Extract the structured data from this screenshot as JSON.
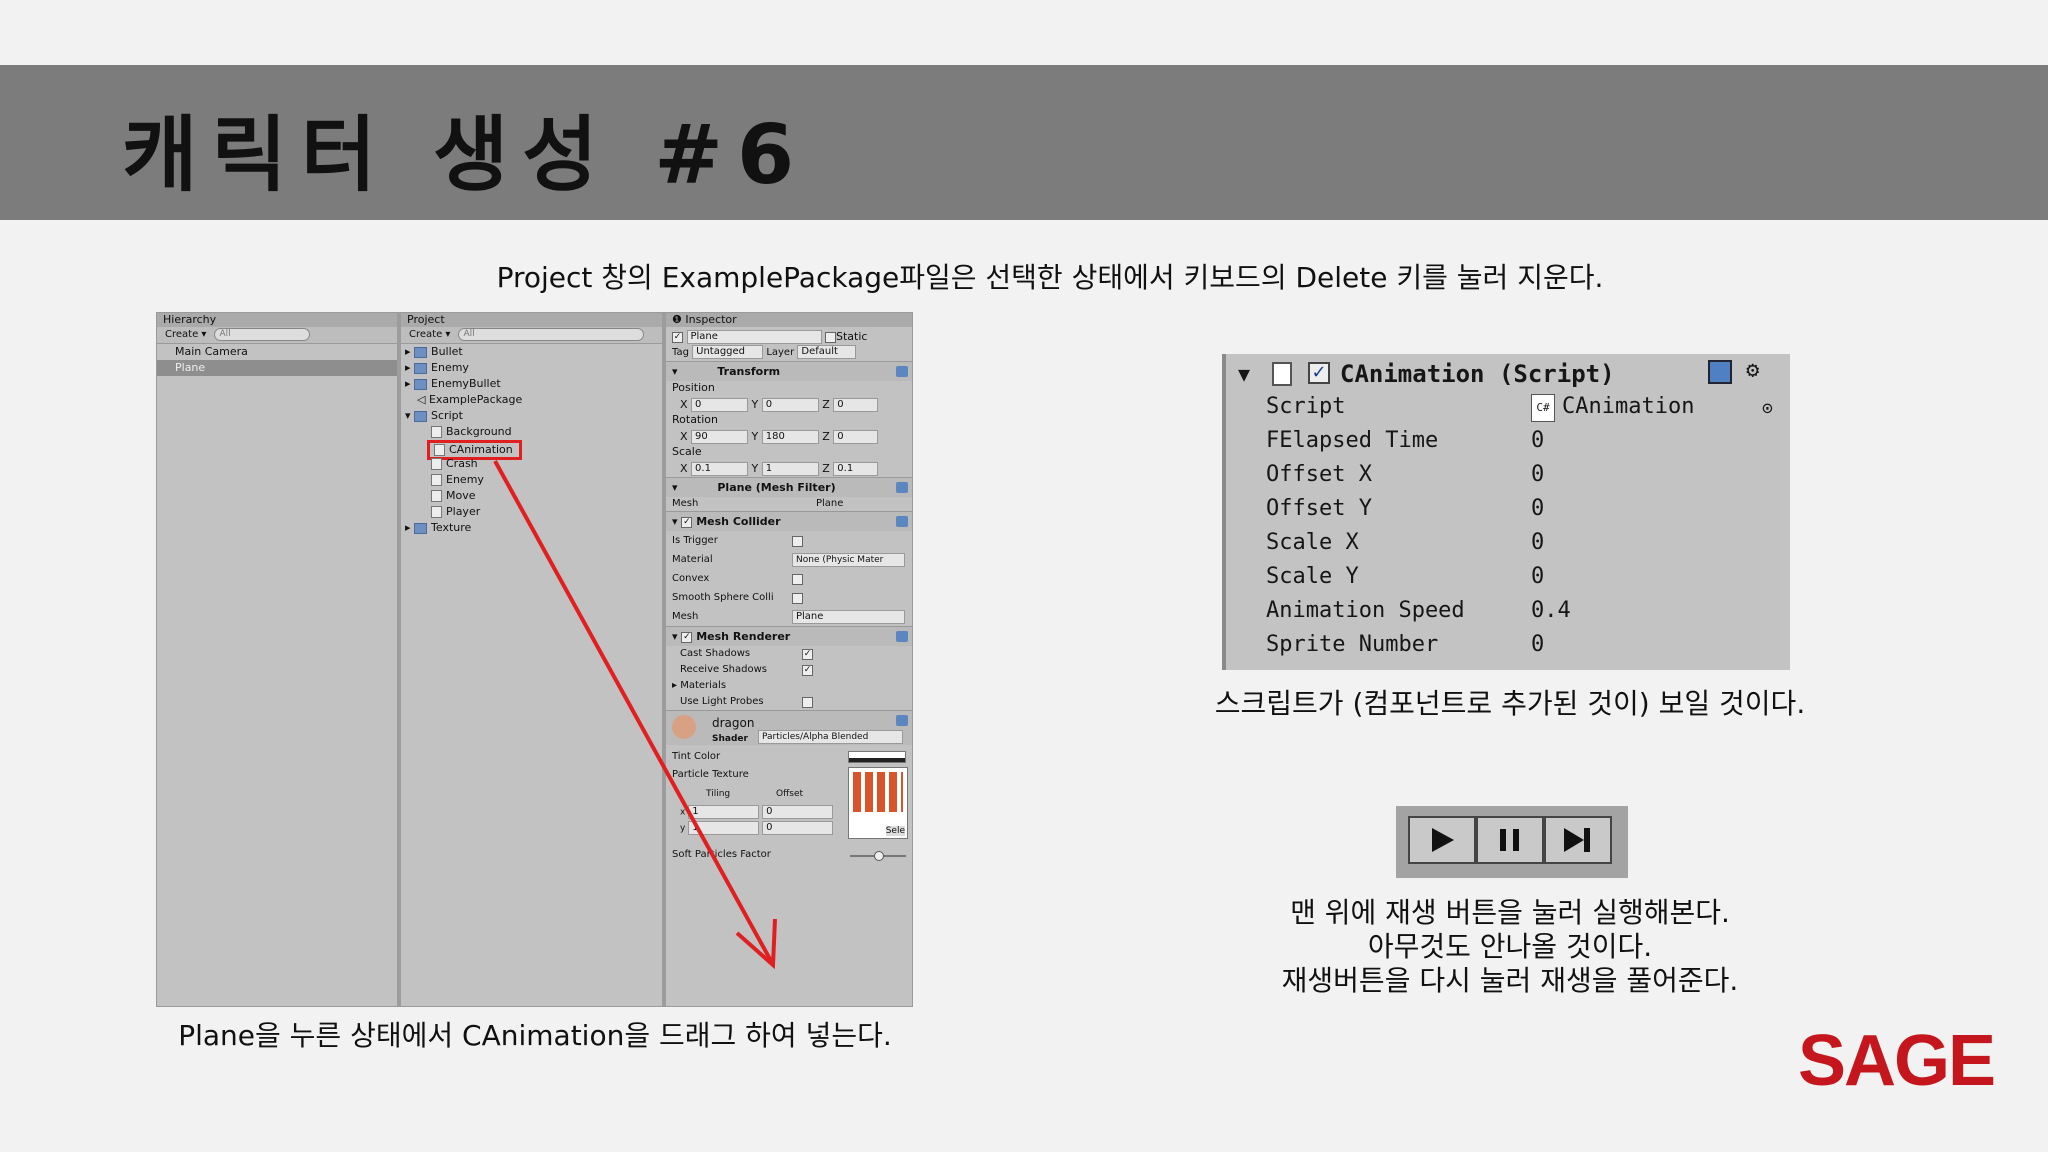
{
  "slide": {
    "title": "캐릭터 생성 #6",
    "caption_top": "Project 창의 ExamplePackage파일은 선택한 상태에서 키보드의 Delete 키를 눌러 지운다.",
    "caption_bottom_left": "Plane을 누른 상태에서 CAnimation을 드래그 하여 넣는다.",
    "caption_right_mid": "스크립트가 (컴포넌트로 추가된 것이) 보일 것이다.",
    "caption_right_bottom": [
      "맨 위에 재생 버튼을 눌러 실행해본다.",
      "아무것도 안나올 것이다.",
      "재생버튼을 다시 눌러 재생을 풀어준다."
    ],
    "logo": "SAGE",
    "accent_color": "#c4161c",
    "arrow_color": "#e02020"
  },
  "hierarchy": {
    "title": "Hierarchy",
    "create": "Create",
    "search": "All",
    "items": [
      "Main Camera",
      "Plane"
    ],
    "selected": "Plane"
  },
  "project": {
    "title": "Project",
    "create": "Create",
    "search": "All",
    "items": [
      "Bullet",
      "Enemy",
      "EnemyBullet",
      "ExamplePackage",
      "Script",
      "Background",
      "CAnimation",
      "Crash",
      "Enemy",
      "Move",
      "Player",
      "Texture"
    ]
  },
  "inspector": {
    "title": "Inspector",
    "object_name": "Plane",
    "static_label": "Static",
    "tag_label": "Tag",
    "tag_value": "Untagged",
    "layer_label": "Layer",
    "layer_value": "Default",
    "transform": {
      "header": "Transform",
      "position_label": "Position",
      "rotation_label": "Rotation",
      "scale_label": "Scale",
      "position": [
        "0",
        "0",
        "0"
      ],
      "rotation": [
        "90",
        "180",
        "0"
      ],
      "scale": [
        "0.1",
        "1",
        "0.1"
      ]
    },
    "mesh_filter": {
      "header": "Plane (Mesh Filter)",
      "mesh_label": "Mesh",
      "mesh_value": "Plane"
    },
    "mesh_collider": {
      "header": "Mesh Collider",
      "is_trigger": "Is Trigger",
      "material": "Material",
      "material_value": "None (Physic Mater",
      "convex": "Convex",
      "smooth": "Smooth Sphere Colli",
      "mesh": "Mesh",
      "mesh_value": "Plane"
    },
    "mesh_renderer": {
      "header": "Mesh Renderer",
      "cast_shadows": "Cast Shadows",
      "receive_shadows": "Receive Shadows",
      "materials": "Materials",
      "light_probes": "Use Light Probes"
    },
    "material": {
      "name": "dragon",
      "shader_label": "Shader",
      "shader_value": "Particles/Alpha Blended",
      "tint_color": "Tint Color",
      "particle_texture": "Particle Texture",
      "tiling": "Tiling",
      "offset": "Offset",
      "tiling_x": "1",
      "tiling_y": "1",
      "offset_x": "0",
      "offset_y": "0",
      "select": "Sele",
      "soft_particles": "Soft Particles Factor"
    }
  },
  "canimation_panel": {
    "header": "CAnimation (Script)",
    "rows": [
      {
        "label": "Script",
        "value": "CAnimation"
      },
      {
        "label": "FElapsed Time",
        "value": "0"
      },
      {
        "label": "Offset X",
        "value": "0"
      },
      {
        "label": "Offset Y",
        "value": "0"
      },
      {
        "label": "Scale X",
        "value": "0"
      },
      {
        "label": "Scale Y",
        "value": "0"
      },
      {
        "label": "Animation Speed",
        "value": "0.4"
      },
      {
        "label": "Sprite Number",
        "value": "0"
      }
    ]
  },
  "playbar": {
    "buttons": [
      "play-icon",
      "pause-icon",
      "step-icon"
    ]
  }
}
